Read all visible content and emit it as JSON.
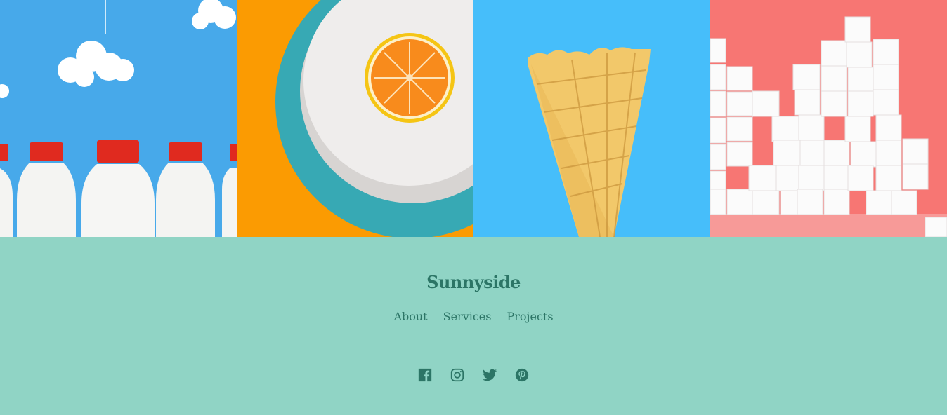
{
  "gallery": {
    "images": [
      {
        "name": "milk-bottles-photo",
        "alt": "Milk bottles with clouds"
      },
      {
        "name": "orange-plate-photo",
        "alt": "Orange on a plate"
      },
      {
        "name": "ice-cream-cone-photo",
        "alt": "Waffle cone"
      },
      {
        "name": "sugar-cubes-photo",
        "alt": "Sugar cubes"
      }
    ]
  },
  "footer": {
    "brand": "Sunnyside",
    "nav": [
      "About",
      "Services",
      "Projects"
    ],
    "social": [
      "facebook-icon",
      "instagram-icon",
      "twitter-icon",
      "pinterest-icon"
    ]
  },
  "colors": {
    "footer_bg": "#90d4c5",
    "footer_text": "#2c7566"
  }
}
